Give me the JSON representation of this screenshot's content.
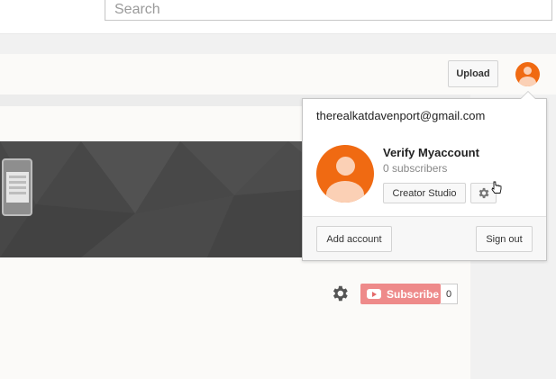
{
  "masthead": {
    "search": {
      "placeholder": "Search",
      "value": ""
    }
  },
  "header": {
    "upload_label": "Upload"
  },
  "channel": {
    "subscribe_label": "Subscribe",
    "subscriber_count": "0"
  },
  "account_popup": {
    "email": "therealkatdavenport@gmail.com",
    "account_name": "Verify Myaccount",
    "subscribers": "0 subscribers",
    "creator_studio_label": "Creator Studio",
    "add_account_label": "Add account",
    "sign_out_label": "Sign out"
  },
  "colors": {
    "avatar": "#f06a12",
    "subscribe": "#ee8a8a",
    "banner": "#474747"
  },
  "icons": [
    "avatar-icon",
    "gear-icon",
    "youtube-play-icon",
    "pointer-cursor-icon",
    "device-thumbnail-icon"
  ]
}
